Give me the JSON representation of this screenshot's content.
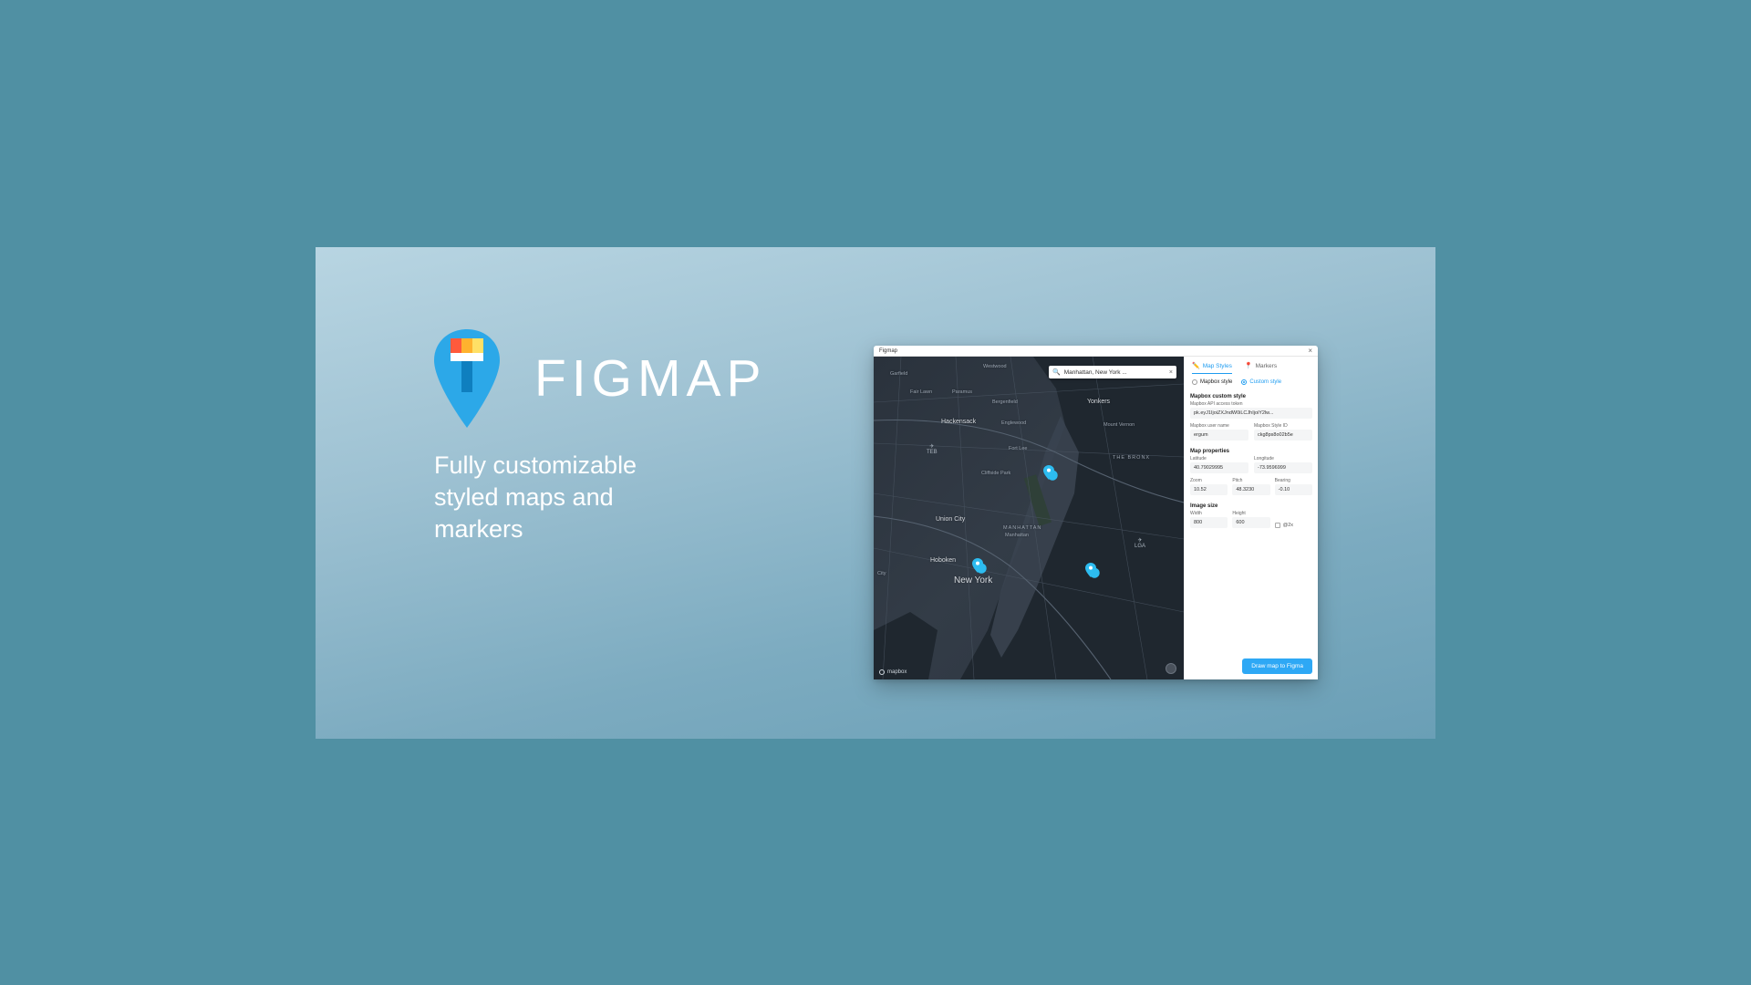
{
  "brand": {
    "name": "FIGMAP",
    "tagline": "Fully customizable styled maps and markers"
  },
  "plugin": {
    "title": "Figmap",
    "search_value": "Manhattan, New York ...",
    "attribution": "mapbox",
    "tabs": {
      "styles": "Map Styles",
      "markers": "Markers"
    },
    "style_radio": {
      "mapbox": "Mapbox style",
      "custom": "Custom style"
    },
    "custom_section": {
      "heading": "Mapbox custom style",
      "token_label": "Mapbox API access token",
      "token_value": "pk.eyJ1IjoiZXJndW0iLCJhIjoiY2lw...",
      "user_label": "Mapbox user name",
      "user_value": "ergum",
      "styleid_label": "Mapbox Style ID",
      "styleid_value": "ckg8ps8o02b5e"
    },
    "props": {
      "heading": "Map properties",
      "lat_label": "Latitude",
      "lat_value": "40.79029995",
      "lng_label": "Longitude",
      "lng_value": "-73.9596999",
      "zoom_label": "Zoom",
      "zoom_value": "10.52",
      "pitch_label": "Pitch",
      "pitch_value": "48.3230",
      "bearing_label": "Bearing",
      "bearing_value": "-0.10"
    },
    "image": {
      "heading": "Image size",
      "w_label": "Width",
      "w_value": "800",
      "h_label": "Height",
      "h_value": "600",
      "retina_label": "@2x"
    },
    "cta": "Draw map to Figma"
  },
  "cities": {
    "newyork": "New York",
    "hoboken": "Hoboken",
    "unioncity": "Union City",
    "cliffside": "Cliffside Park",
    "fortlee": "Fort Lee",
    "englewood": "Englewood",
    "hackensack": "Hackensack",
    "bergenfield": "Bergenfield",
    "paramus": "Paramus",
    "fairlawn": "Fair Lawn",
    "garfield": "Garfield",
    "westwood": "Westwood",
    "yonkers": "Yonkers",
    "mtvernon": "Mount Vernon",
    "manhattan": "Manhattan",
    "manhattan_area": "MANHATTAN",
    "bronx": "THE BRONX",
    "city": "City",
    "teb": "TEB",
    "lga": "LGA"
  }
}
